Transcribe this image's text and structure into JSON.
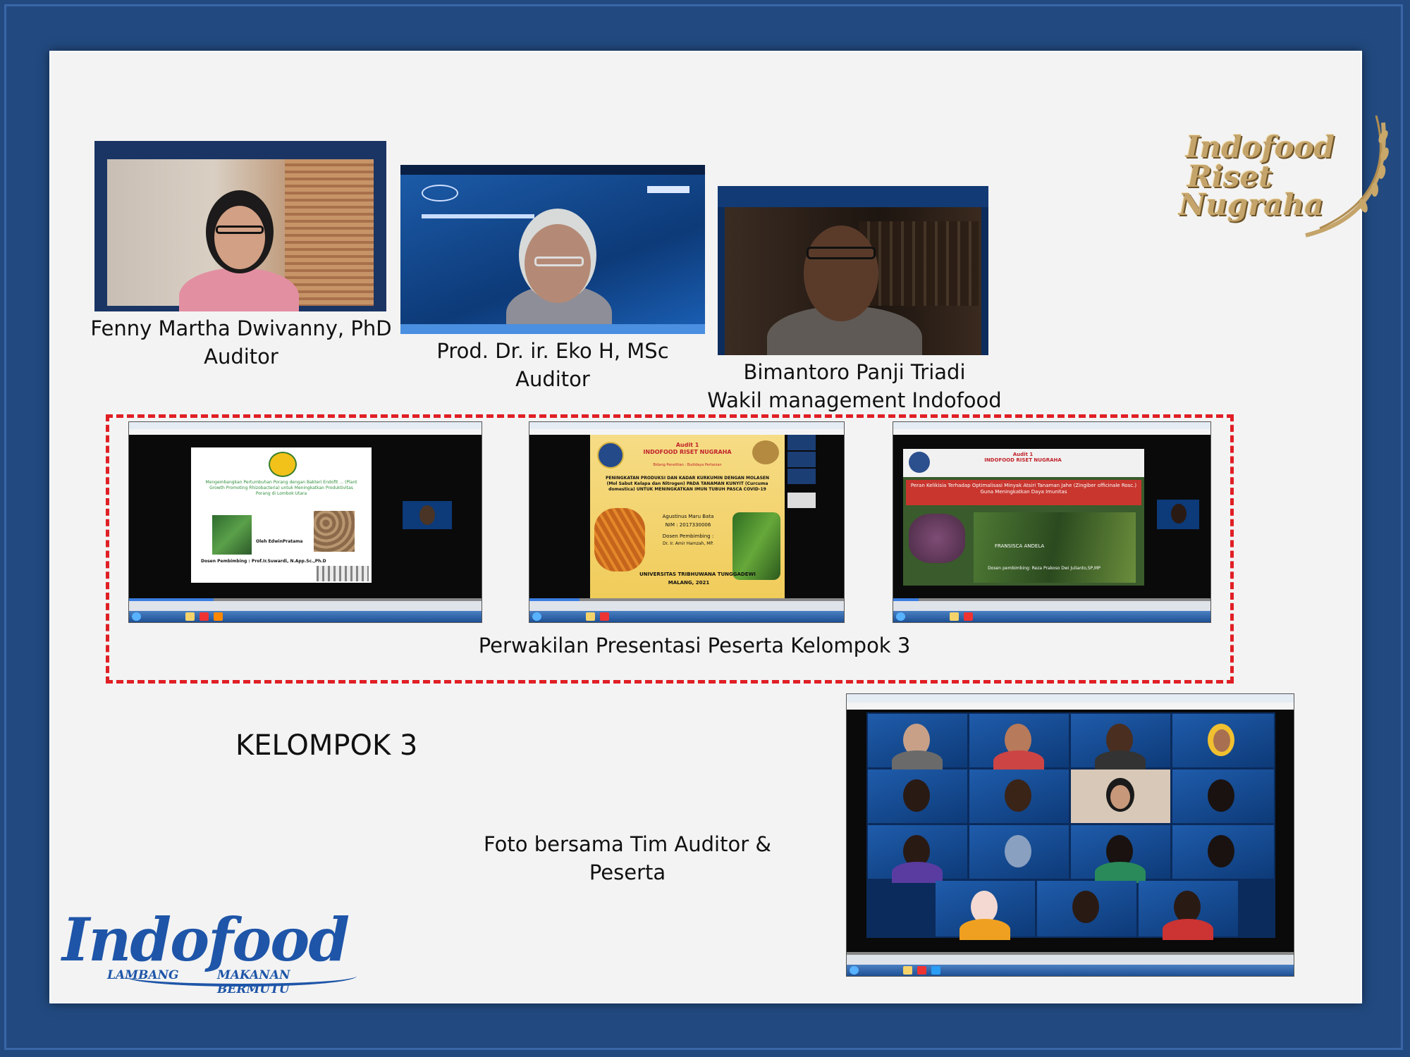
{
  "auditors": [
    {
      "name": "Fenny Martha Dwivanny, PhD",
      "role": "Auditor"
    },
    {
      "name": "Prod. Dr. ir. Eko H, MSc",
      "role": "Auditor"
    },
    {
      "name": "Bimantoro Panji Triadi",
      "role": "Wakil management Indofood"
    }
  ],
  "presentation_caption": "Perwakilan Presentasi Peserta Kelompok 3",
  "group_title": "KELOMPOK 3",
  "group_photo_caption": "Foto bersama Tim Auditor & Peserta",
  "logo_riset": {
    "line1": "Indofood",
    "line2": "Riset",
    "line3": "Nugraha"
  },
  "logo_indofood": {
    "word": "Indofood",
    "tag_left": "LAMBANG",
    "tag_right": "MAKANAN BERMUTU"
  },
  "slides": [
    {
      "title": "Mengembangkan Pertumbuhan Porang dengan Bakteri Endofit ... (Plant Growth Promoting Rhizobacteria) untuk Meningkatkan Produktivitas Porang di Lombok Utara",
      "author": "Oleh EdwinPratama",
      "supervisor": "Dosen Pembimbing : Prof.Ir.Suwardi, N.App.Sc.,Ph.D"
    },
    {
      "header": "Audit 1",
      "org": "INDOFOOD RISET NUGRAHA",
      "field": "Bidang Penelitian : Budidaya Pertanian",
      "title": "PENINGKATAN PRODUKSI DAN KADAR KURKUMIN DENGAN MOLASEN (Mol Sabut Kelapa dan Nitrogen) PADA TANAMAN KUNYIT (Curcuma domestica) UNTUK MENINGKATKAN IMUN TUBUH PASCA COVID-19",
      "author": "Agustinus Maru Bata",
      "nim": "NIM : 2017330006",
      "supervisor_label": "Dosen Pembimbing :",
      "supervisor": "Dr. Ir. Amir Hamzah, MP.",
      "university": "UNIVERSITAS TRIBHUWANA TUNGGADEWI",
      "city": "MALANG, 2021"
    },
    {
      "header": "Audit 1",
      "org": "INDOFOOD RISET NUGRAHA",
      "title": "Peran Kelikisia Terhadap Optimalisasi Minyak Atsiri Tanaman Jahe (Zingiber officinale Rosc.) Guna Meningkatkan Daya Imunitas",
      "author": "FRANSISCA ANDELA",
      "supervisor": "Dosen pembimbing: Reza Prakoso Dwi Julianto,SP,MP"
    }
  ],
  "icons": [
    "play-icon",
    "stop-icon",
    "windows-start-icon"
  ]
}
